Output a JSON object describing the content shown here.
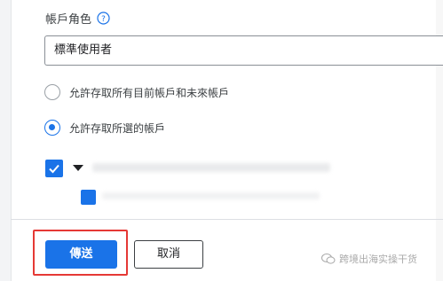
{
  "role_section": {
    "label": "帳戶角色",
    "help_icon": "help-circle-icon",
    "field_value": "標準使用者"
  },
  "access_options": [
    {
      "label": "允許存取所有目前帳戶和未來帳戶",
      "selected": false
    },
    {
      "label": "允許存取所選的帳戶",
      "selected": true
    }
  ],
  "account_tree": {
    "parent_checked": true,
    "child_checked": true,
    "expand_icon": "caret-down-icon"
  },
  "footer": {
    "submit_label": "傳送",
    "cancel_label": "取消"
  },
  "watermark": {
    "text": "跨境出海实操干货",
    "icon": "wechat-icon"
  },
  "colors": {
    "accent": "#1a73e8",
    "highlight": "#e53935"
  }
}
